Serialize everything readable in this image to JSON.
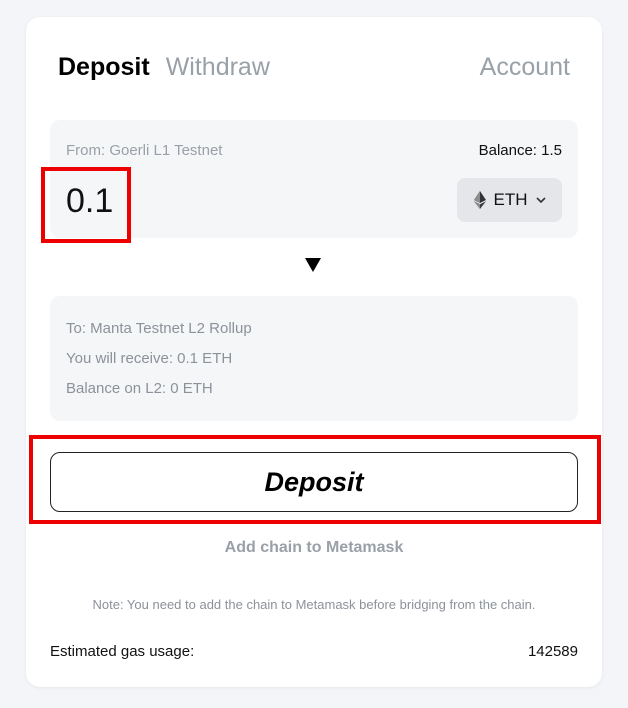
{
  "tabs": {
    "deposit": "Deposit",
    "withdraw": "Withdraw",
    "account": "Account"
  },
  "from_panel": {
    "label": "From: Goerli L1 Testnet",
    "balance": "Balance: 1.5",
    "amount": "0.1",
    "token": "ETH",
    "token_icon": "ethereum-icon"
  },
  "to_panel": {
    "destination": "To: Manta Testnet L2 Rollup",
    "receive": "You will receive: 0.1 ETH",
    "l2_balance": "Balance on L2: 0 ETH"
  },
  "actions": {
    "deposit_label": "Deposit",
    "add_chain_label": "Add chain to Metamask"
  },
  "note": "Note: You need to add the chain to Metamask before bridging from the chain.",
  "gas": {
    "label": "Estimated gas usage:",
    "value": "142589"
  },
  "colors": {
    "highlight": "#ee0000",
    "muted_text": "#9aa0a8",
    "panel_bg": "#f5f6f8"
  }
}
